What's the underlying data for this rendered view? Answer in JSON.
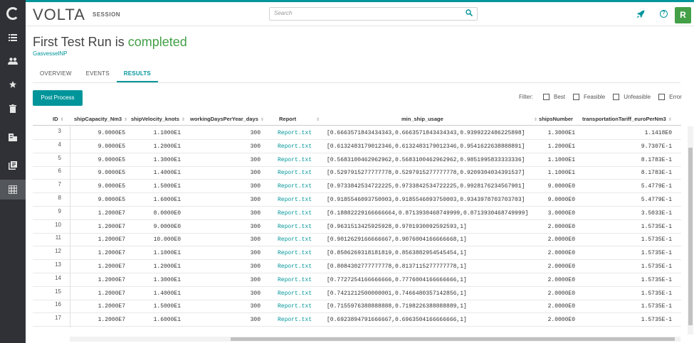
{
  "sidebar": {
    "items": [
      {
        "icon": "list-icon",
        "active": false
      },
      {
        "icon": "people-icon",
        "active": false
      },
      {
        "icon": "star-icon",
        "active": false
      },
      {
        "icon": "trash-icon",
        "active": false
      },
      {
        "icon": "building-icon",
        "active": false
      },
      {
        "icon": "library-icon",
        "active": false
      },
      {
        "icon": "grid-icon",
        "active": true
      }
    ]
  },
  "header": {
    "brand": "VOLTA",
    "brand_sub": "SESSION",
    "search_placeholder": "Search",
    "avatar_letter": "R"
  },
  "page": {
    "title_prefix": "First Test Run is ",
    "title_status": "completed",
    "subtitle": "GasvesselNP",
    "tabs": [
      "OVERVIEW",
      "EVENTS",
      "RESULTS"
    ],
    "active_tab": "RESULTS"
  },
  "toolbar": {
    "post_process_label": "Post Process",
    "filter_label": "Filter:",
    "filters": [
      "Best",
      "Feasible",
      "Unfeasible",
      "Error"
    ]
  },
  "table": {
    "columns": [
      "ID",
      "shipCapacity_Nm3",
      "shipVelocity_knots",
      "workingDaysPerYear_days",
      "Report",
      "min_ship_usage",
      "shipsNumber",
      "transportationTariff_euroPerNm3"
    ],
    "ids": [
      "3",
      "4",
      "5",
      "6",
      "7",
      "8",
      "9",
      "10",
      "11",
      "12",
      "13",
      "14",
      "15",
      "16",
      "17"
    ],
    "rows": [
      [
        "9.0000E5",
        "1.1000E1",
        "300",
        "Report.txt",
        "[0.6663571843434343,0.6663571843434343,0.9399222486225898]",
        "1.3000E1",
        "1.1418E0"
      ],
      [
        "9.0000E5",
        "1.2000E1",
        "300",
        "Report.txt",
        "[0.6132483179012346,0.6132483179012346,0.9541622638888891]",
        "1.2000E1",
        "9.7307E-1"
      ],
      [
        "9.0000E5",
        "1.3000E1",
        "300",
        "Report.txt",
        "[0.5683100462962962,0.5683100462962962,0.9851995833333336]",
        "1.1000E1",
        "8.1783E-1"
      ],
      [
        "9.0000E5",
        "1.4000E1",
        "300",
        "Report.txt",
        "[0.5297915277777778,0.5297915277777778,0.9209304034391537]",
        "1.1000E1",
        "8.1783E-1"
      ],
      [
        "9.0000E5",
        "1.5000E1",
        "300",
        "Report.txt",
        "[0.9733842534722225,0.9733842534722225,0.9928176234567901]",
        "9.0000E0",
        "5.4779E-1"
      ],
      [
        "9.0000E5",
        "1.6000E1",
        "300",
        "Report.txt",
        "[0.9185546093750003,0.9185546093750003,0.9343978703703703]",
        "9.0000E0",
        "5.4779E-1"
      ],
      [
        "1.2000E7",
        "8.0000E0",
        "300",
        "Report.txt",
        "[0.18882229166666664,0.8713930468749999,0.8713930468749999]",
        "3.0000E0",
        "3.5033E-1"
      ],
      [
        "1.2000E7",
        "9.0000E0",
        "300",
        "Report.txt",
        "[0.9631513425925928,0.9701930092592593,1]",
        "2.0000E0",
        "1.5735E-1"
      ],
      [
        "1.2000E7",
        "10.000E0",
        "300",
        "Report.txt",
        "[0.9012629166666667,0.9076004166666668,1]",
        "2.0000E0",
        "1.5735E-1"
      ],
      [
        "1.2000E7",
        "1.1000E1",
        "300",
        "Report.txt",
        "[0.8506269318181819,0.8563882954545454,1]",
        "2.0000E0",
        "1.5735E-1"
      ],
      [
        "1.2000E7",
        "1.2000E1",
        "300",
        "Report.txt",
        "[0.8084302777777778,0.8137115277777778,1]",
        "2.0000E0",
        "1.5735E-1"
      ],
      [
        "1.2000E7",
        "1.3000E1",
        "300",
        "Report.txt",
        "[0.7727254166666666,0.7776004166666666,1]",
        "2.0000E0",
        "1.5735E-1"
      ],
      [
        "1.2000E7",
        "1.4000E1",
        "300",
        "Report.txt",
        "[0.7421212500000001,0.7466480357142856,1]",
        "2.0000E0",
        "1.5735E-1"
      ],
      [
        "1.2000E7",
        "1.5000E1",
        "300",
        "Report.txt",
        "[0.7155976388888888,0.7198226388888889,1]",
        "2.0000E0",
        "1.5735E-1"
      ],
      [
        "1.2000E7",
        "1.6000E1",
        "300",
        "Report.txt",
        "[0.6923894791666667,0.6963504166666666,1]",
        "2.0000E0",
        "1.5735E-1"
      ]
    ]
  },
  "colors": {
    "accent": "#00959a",
    "completed": "#43a047",
    "sidebar_bg": "#2f3136"
  }
}
